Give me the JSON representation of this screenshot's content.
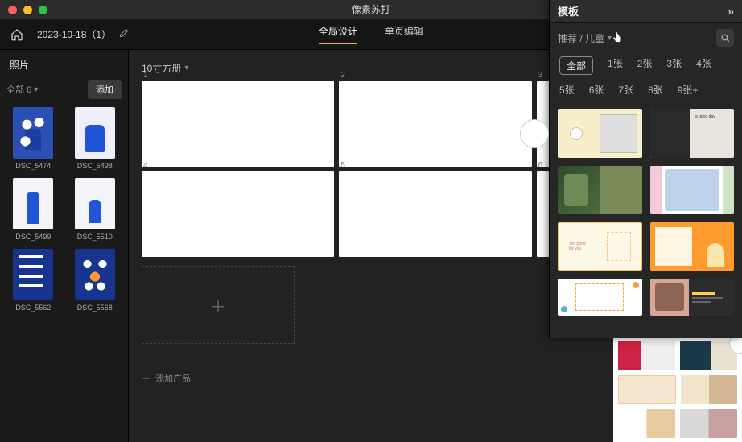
{
  "titlebar": {
    "app_name": "像素苏打"
  },
  "project": {
    "name": "2023-10-18（1）",
    "tabs": [
      {
        "label": "全局设计",
        "active": true
      },
      {
        "label": "单页编辑",
        "active": false
      }
    ]
  },
  "photos": {
    "title": "照片",
    "group_label": "全部 6",
    "add_label": "添加",
    "items": [
      {
        "label": "DSC_5474"
      },
      {
        "label": "DSC_5498"
      },
      {
        "label": "DSC_5499"
      },
      {
        "label": "DSC_5510"
      },
      {
        "label": "DSC_5562"
      },
      {
        "label": "DSC_5568"
      }
    ]
  },
  "canvas": {
    "size_label": "10寸方册",
    "pages": [
      "1",
      "2",
      "3",
      "4",
      "5",
      "6"
    ],
    "add_product_label": "添加产品"
  },
  "templates": {
    "title": "模板",
    "breadcrumb": "推荐 / 儿童",
    "chips": [
      "全部",
      "1张",
      "2张",
      "3张",
      "4张",
      "5张",
      "6张",
      "7张",
      "8张",
      "9张+"
    ],
    "active_chip": "全部"
  }
}
